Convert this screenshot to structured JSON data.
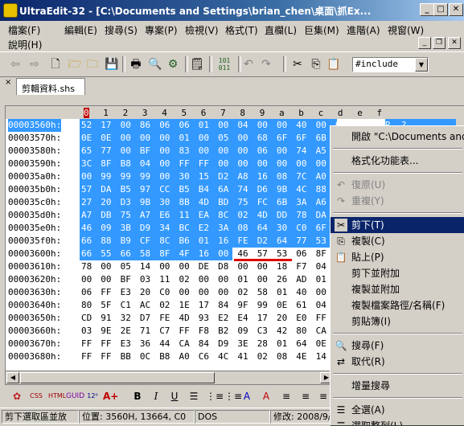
{
  "titlebar": {
    "title": "UltraEdit-32 - [C:\\Documents and Settings\\brian_chen\\桌面\\抓Ex...",
    "minimize": "_",
    "maximize": "□",
    "close": "✕"
  },
  "menu": {
    "items": [
      "檔案(F)",
      "編輯(E)",
      "搜尋(S)",
      "專案(P)",
      "檢視(V)",
      "格式(T)",
      "直欄(L)",
      "巨集(M)",
      "進階(A)",
      "視窗(W)",
      "說明(H)"
    ]
  },
  "toolbar": {
    "find_value": "#include"
  },
  "tab": {
    "label": "剪輯資料.shs",
    "close": "×"
  },
  "hex": {
    "ruler": [
      "0",
      "1",
      "2",
      "3",
      "4",
      "5",
      "6",
      "7",
      "8",
      "9",
      "a",
      "b",
      "c",
      "d",
      "e",
      "f"
    ],
    "rows": [
      {
        "addr": "00003560h:",
        "bytes": "52 17 00 86 06 06 01 00 04 00 00 40 00 00 3F"
      },
      {
        "addr": "00003570h:",
        "bytes": "0E 0E 00 00 00 01 00 05 00 68 6F 6F 6B"
      },
      {
        "addr": "00003580h:",
        "bytes": "65 77 00 BF 00 83 00 00 00 06 00 74 A5"
      },
      {
        "addr": "00003590h:",
        "bytes": "3C 8F B8 04 00 FF FF 00 00 00 00 00 00"
      },
      {
        "addr": "000035a0h:",
        "bytes": "00 99 99 99 00 30 15 D2 A8 16 08 7C A0"
      },
      {
        "addr": "000035b0h:",
        "bytes": "57 DA B5 97 CC B5 B4 6A 74 D6 9B 4C 88"
      },
      {
        "addr": "000035c0h:",
        "bytes": "27 20 D3 9B 30 8B 4D BD 75 FC 6B 3A A6"
      },
      {
        "addr": "000035d0h:",
        "bytes": "A7 DB 75 A7 E6 11 EA 8C 02 4D DD 78 DA"
      },
      {
        "addr": "000035e0h:",
        "bytes": "46 09 3B D9 34 BC E2 3A 08 64 30 C0 6F"
      },
      {
        "addr": "000035f0h:",
        "bytes": "66 88 B9 CF 8C B6 01 16 FE D2 64 77 53"
      },
      {
        "addr": "00003600h:",
        "bytes": "66 55 66 58 8F 4F 16 00 46 57 53 06 8F"
      },
      {
        "addr": "00003610h:",
        "bytes": "78 00 05 14 00 00 DE D8 00 00 18 F7 04"
      },
      {
        "addr": "00003620h:",
        "bytes": "00 00 BF 03 11 02 00 00 01 00 26 AD 01"
      },
      {
        "addr": "00003630h:",
        "bytes": "06 FF E3 20 C0 00 00 00 02 58 01 40 00"
      },
      {
        "addr": "00003640h:",
        "bytes": "80 5F C1 AC 02 1E 17 84 9F 99 0E 61 04"
      },
      {
        "addr": "00003650h:",
        "bytes": "CD 91 32 D7 FE 4D 93 E2 E4 17 20 E0 FF"
      },
      {
        "addr": "00003660h:",
        "bytes": "03 9E 2E 71 C7 FF F8 B2 09 C3 42 80 CA"
      },
      {
        "addr": "00003670h:",
        "bytes": "FF FF E3 36 44 CA 84 D9 3E 28 01 64 0E"
      },
      {
        "addr": "00003680h:",
        "bytes": "FF FF BB 0C B8 A0 C6 4C 41 02 08 4E 14"
      }
    ],
    "ascii_fragment": "R  ?"
  },
  "context_menu": {
    "items": [
      {
        "label": "開啟 \"C:\\Documents and Sett",
        "type": "item"
      },
      {
        "type": "sep"
      },
      {
        "label": "格式化功能表...",
        "type": "item"
      },
      {
        "type": "sep"
      },
      {
        "label": "復原(U)",
        "type": "item",
        "icon": "↶",
        "disabled": true
      },
      {
        "label": "重複(Y)",
        "type": "item",
        "icon": "↷",
        "disabled": true
      },
      {
        "type": "sep"
      },
      {
        "label": "剪下(T)",
        "type": "item",
        "icon": "✂",
        "highlight": true
      },
      {
        "label": "複製(C)",
        "type": "item",
        "icon": "⎘"
      },
      {
        "label": "貼上(P)",
        "type": "item",
        "icon": "📋"
      },
      {
        "label": "剪下並附加",
        "type": "item"
      },
      {
        "label": "複製並附加",
        "type": "item"
      },
      {
        "label": "複製檔案路徑/名稱(F)",
        "type": "item"
      },
      {
        "label": "剪貼簿(I)",
        "type": "item"
      },
      {
        "type": "sep"
      },
      {
        "label": "搜尋(F)",
        "type": "item",
        "icon": "🔍"
      },
      {
        "label": "取代(R)",
        "type": "item",
        "icon": "⇄"
      },
      {
        "type": "sep"
      },
      {
        "label": "增量搜尋",
        "type": "item"
      },
      {
        "type": "sep"
      },
      {
        "label": "全選(A)",
        "type": "item",
        "icon": "☰"
      },
      {
        "label": "選取整列(L)",
        "type": "item",
        "icon": "☰"
      }
    ]
  },
  "statusbar": {
    "hint": "剪下選取區並放",
    "position": "位置: 3560H, 13664, C0",
    "format": "DOS",
    "modified": "修改: 2008/9/"
  },
  "colors": {
    "selection": "#3399ff",
    "highlight": "#0a246a",
    "underline": "#e00000"
  }
}
